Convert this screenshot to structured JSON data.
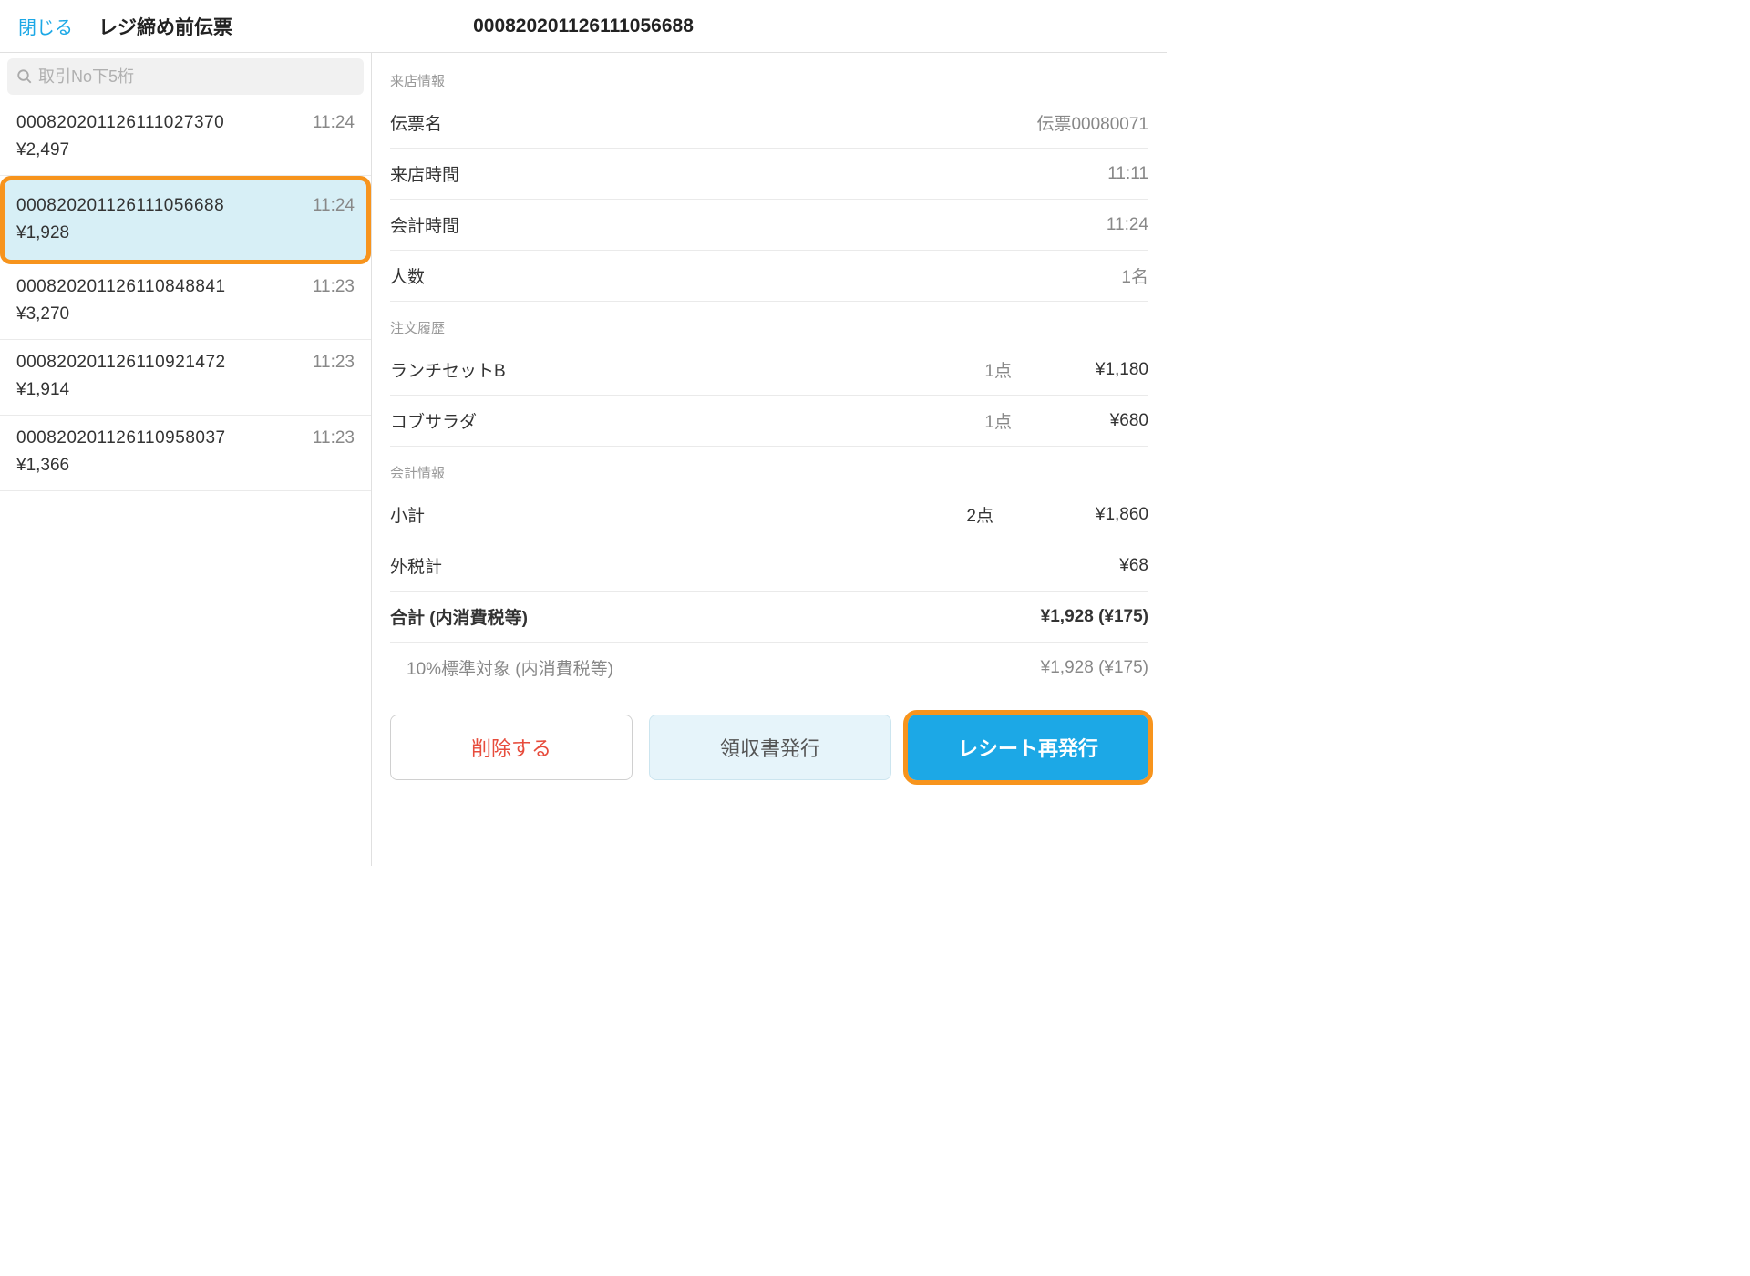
{
  "header": {
    "close": "閉じる",
    "left_title": "レジ締め前伝票",
    "center_title": "000820201126111056688"
  },
  "search": {
    "placeholder": "取引No下5桁"
  },
  "transactions": [
    {
      "id": "000820201126111027370",
      "time": "11:24",
      "amount": "¥2,497",
      "selected": false
    },
    {
      "id": "000820201126111056688",
      "time": "11:24",
      "amount": "¥1,928",
      "selected": true
    },
    {
      "id": "000820201126110848841",
      "time": "11:23",
      "amount": "¥3,270",
      "selected": false
    },
    {
      "id": "000820201126110921472",
      "time": "11:23",
      "amount": "¥1,914",
      "selected": false
    },
    {
      "id": "000820201126110958037",
      "time": "11:23",
      "amount": "¥1,366",
      "selected": false
    }
  ],
  "detail": {
    "visit_section": "来店情報",
    "rows": {
      "slip_name": {
        "label": "伝票名",
        "value": "伝票00080071"
      },
      "visit_time": {
        "label": "来店時間",
        "value": "11:11"
      },
      "checkout_time": {
        "label": "会計時間",
        "value": "11:24"
      },
      "guests": {
        "label": "人数",
        "value": "1名"
      }
    },
    "order_section": "注文履歴",
    "orders": [
      {
        "name": "ランチセットB",
        "qty": "1点",
        "price": "¥1,180"
      },
      {
        "name": "コブサラダ",
        "qty": "1点",
        "price": "¥680"
      }
    ],
    "summary_section": "会計情報",
    "summary": {
      "subtotal": {
        "label": "小計",
        "qty": "2点",
        "value": "¥1,860"
      },
      "tax_excl": {
        "label": "外税計",
        "value": "¥68"
      },
      "total": {
        "label": "合計 (内消費税等)",
        "value": "¥1,928 (¥175)"
      },
      "tax10": {
        "label": "10%標準対象 (内消費税等)",
        "value": "¥1,928 (¥175)"
      }
    }
  },
  "actions": {
    "delete": "削除する",
    "receipt": "領収書発行",
    "reprint": "レシート再発行"
  }
}
